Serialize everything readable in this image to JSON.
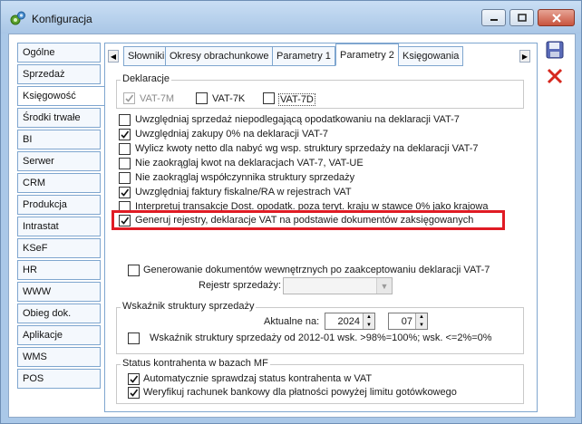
{
  "window": {
    "title": "Konfiguracja"
  },
  "nav": {
    "items": [
      {
        "label": "Ogólne"
      },
      {
        "label": "Sprzedaż"
      },
      {
        "label": "Księgowość"
      },
      {
        "label": "Środki trwałe"
      },
      {
        "label": "BI"
      },
      {
        "label": "Serwer wydruków"
      },
      {
        "label": "CRM"
      },
      {
        "label": "Produkcja"
      },
      {
        "label": "Intrastat"
      },
      {
        "label": "KSeF"
      },
      {
        "label": "HR"
      },
      {
        "label": "WWW"
      },
      {
        "label": "Obieg dok."
      },
      {
        "label": "Aplikacje"
      },
      {
        "label": "WMS"
      },
      {
        "label": "POS"
      }
    ],
    "active": "Księgowość"
  },
  "tabs": {
    "items": [
      {
        "label": "Słowniki"
      },
      {
        "label": "Okresy obrachunkowe"
      },
      {
        "label": "Parametry 1"
      },
      {
        "label": "Parametry 2"
      },
      {
        "label": "Księgowania"
      }
    ],
    "active": "Parametry 2"
  },
  "deklaracje": {
    "title": "Deklaracje",
    "vat7m": {
      "label": "VAT-7M",
      "checked": true,
      "disabled": true
    },
    "vat7k": {
      "label": "VAT-7K",
      "checked": false
    },
    "vat7d": {
      "label": "VAT-7D",
      "checked": false
    }
  },
  "options": [
    {
      "label": "Uwzględniaj sprzedaż niepodlegającą opodatkowaniu na deklaracji VAT-7",
      "checked": false
    },
    {
      "label": "Uwzględniaj zakupy 0% na deklaracji VAT-7",
      "checked": true
    },
    {
      "label": "Wylicz kwoty netto dla nabyć wg wsp. struktury sprzedaży na deklaracji VAT-7",
      "checked": false
    },
    {
      "label": "Nie zaokrąglaj kwot na deklaracjach VAT-7, VAT-UE",
      "checked": false
    },
    {
      "label": "Nie zaokrąglaj współczynnika struktury sprzedaży",
      "checked": false
    },
    {
      "label": "Uwzględniaj faktury fiskalne/RA w rejestrach VAT",
      "checked": true
    },
    {
      "label": "Interpretuj transakcje Dost. opodatk. poza teryt. kraju w stawce 0% jako krajowa",
      "checked": false
    },
    {
      "label": "Generuj rejestry, deklaracje VAT na podstawie dokumentów zaksięgowanych",
      "checked": true
    }
  ],
  "dokumenty_wew": {
    "label": "Generowanie dokumentów wewnętrznych po zaakceptowaniu deklaracji VAT-7",
    "checked": false,
    "rejestr_label": "Rejestr sprzedaży:",
    "rejestr_value": ""
  },
  "wskaznik": {
    "title": "Wskaźnik struktury sprzedaży",
    "aktualne_label": "Aktualne na:",
    "year": "2024",
    "month": "07",
    "option_label": "Wskaźnik struktury sprzedaży od 2012-01 wsk. >98%=100%; wsk. <=2%=0%",
    "option_checked": false
  },
  "status_mf": {
    "title": "Status kontrahenta w bazach MF",
    "options": [
      {
        "label": "Automatycznie sprawdzaj status kontrahenta w VAT",
        "checked": true
      },
      {
        "label": "Weryfikuj rachunek bankowy dla płatności powyżej limitu gotówkowego",
        "checked": true
      }
    ]
  },
  "side_buttons": {
    "save_icon": "save-icon",
    "cancel_icon": "close-icon"
  },
  "colors": {
    "highlight": "#e01b24",
    "accent_border": "#7fa6cf"
  }
}
